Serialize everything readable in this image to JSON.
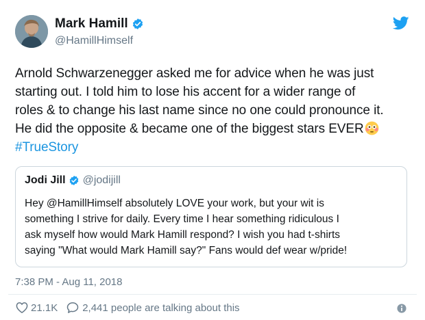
{
  "tweet": {
    "author": {
      "display_name": "Mark Hamill",
      "handle": "@HamillHimself"
    },
    "text_lines": [
      "Arnold Schwarzenegger asked me for advice when he was just",
      "starting out. I told him to lose his accent for a wider range of",
      "roles & to change his last name since no one could pronounce it.",
      "He did the opposite & became one of the biggest stars EVER"
    ],
    "hashtag": "#TrueStory",
    "emoji": "flushed-face-emoji",
    "quoted": {
      "display_name": "Jodi Jill",
      "handle": "@jodijill",
      "text_lines": [
        "Hey @HamillHimself absolutely LOVE your work, but your wit is",
        "something I strive for daily. Every time I hear something ridiculous I",
        "ask myself how would Mark Hamill respond? I wish you had t-shirts",
        "saying \"What would Mark Hamill say?\" Fans would def wear w/pride!"
      ]
    },
    "timestamp": "7:38 PM - Aug 11, 2018",
    "likes": "21.1K",
    "talking": "2,441 people are talking about this"
  },
  "icons": {
    "verified": "verified-badge-icon",
    "brand": "twitter-bird-icon",
    "like": "heart-icon",
    "reply": "speech-bubble-icon",
    "info": "info-icon"
  },
  "colors": {
    "brand_blue": "#1da1f2",
    "link_blue": "#1b95e0",
    "text": "#14171a",
    "secondary_text": "#657786",
    "border": "#ccd6dd"
  }
}
